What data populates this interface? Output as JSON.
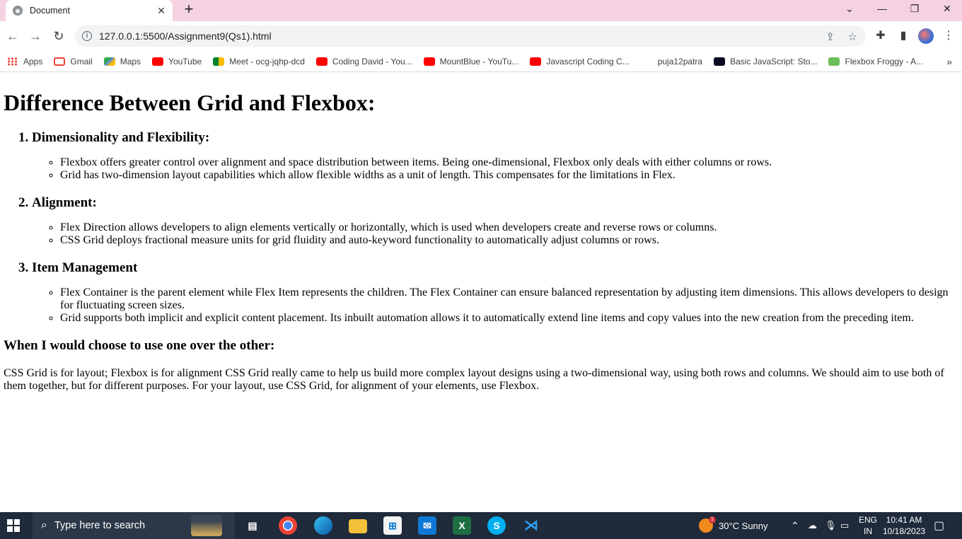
{
  "browser": {
    "tab_title": "Document",
    "url": "127.0.0.1:5500/Assignment9(Qs1).html",
    "bookmarks": [
      {
        "label": "Apps",
        "icon": "apps-grid-icon"
      },
      {
        "label": "Gmail",
        "icon": "gmail-icon"
      },
      {
        "label": "Maps",
        "icon": "maps-icon"
      },
      {
        "label": "YouTube",
        "icon": "youtube-icon"
      },
      {
        "label": "Meet - ocg-jqhp-dcd",
        "icon": "meet-icon"
      },
      {
        "label": "Coding David - You...",
        "icon": "youtube-icon"
      },
      {
        "label": "MountBlue - YouTu...",
        "icon": "youtube-icon"
      },
      {
        "label": "Javascript Coding C...",
        "icon": "youtube-icon"
      },
      {
        "label": "puja12patra",
        "icon": "blank-icon"
      },
      {
        "label": "Basic JavaScript: Sto...",
        "icon": "freecodecamp-icon"
      },
      {
        "label": "Flexbox Froggy - A...",
        "icon": "froggy-icon"
      }
    ],
    "bookmarks_more": "»"
  },
  "page": {
    "title": "Difference Between Grid and Flexbox:",
    "sections": [
      {
        "heading": "Dimensionality and Flexibility:",
        "items": [
          "Flexbox offers greater control over alignment and space distribution between items. Being one-dimensional, Flexbox only deals with either columns or rows.",
          "Grid has two-dimension layout capabilities which allow flexible widths as a unit of length. This compensates for the limitations in Flex."
        ]
      },
      {
        "heading": "Alignment:",
        "items": [
          "Flex Direction allows developers to align elements vertically or horizontally, which is used when developers create and reverse rows or columns.",
          "CSS Grid deploys fractional measure units for grid fluidity and auto-keyword functionality to automatically adjust columns or rows."
        ]
      },
      {
        "heading": "Item Management",
        "items": [
          "Flex Container is the parent element while Flex Item represents the children. The Flex Container can ensure balanced representation by adjusting item dimensions. This allows developers to design for fluctuating screen sizes.",
          "Grid supports both implicit and explicit content placement. Its inbuilt automation allows it to automatically extend line items and copy values into the new creation from the preceding item."
        ]
      }
    ],
    "subheading": "When I would choose to use one over the other:",
    "paragraph": "CSS Grid is for layout; Flexbox is for alignment CSS Grid really came to help us build more complex layout designs using a two-dimensional way, using both rows and columns. We should aim to use both of them together, but for different purposes. For your layout, use CSS Grid, for alignment of your elements, use Flexbox."
  },
  "taskbar": {
    "search_placeholder": "Type here to search",
    "weather_badge": "1",
    "weather": "30°C  Sunny",
    "lang_top": "ENG",
    "lang_bottom": "IN",
    "time": "10:41 AM",
    "date": "10/18/2023",
    "apps": [
      "task-view",
      "chrome",
      "edge",
      "file-explorer",
      "microsoft-store",
      "mail",
      "excel",
      "skype",
      "vscode"
    ]
  },
  "colors": {
    "titlebar": "#f4d2e1",
    "taskbar": "#1f2a3a"
  }
}
